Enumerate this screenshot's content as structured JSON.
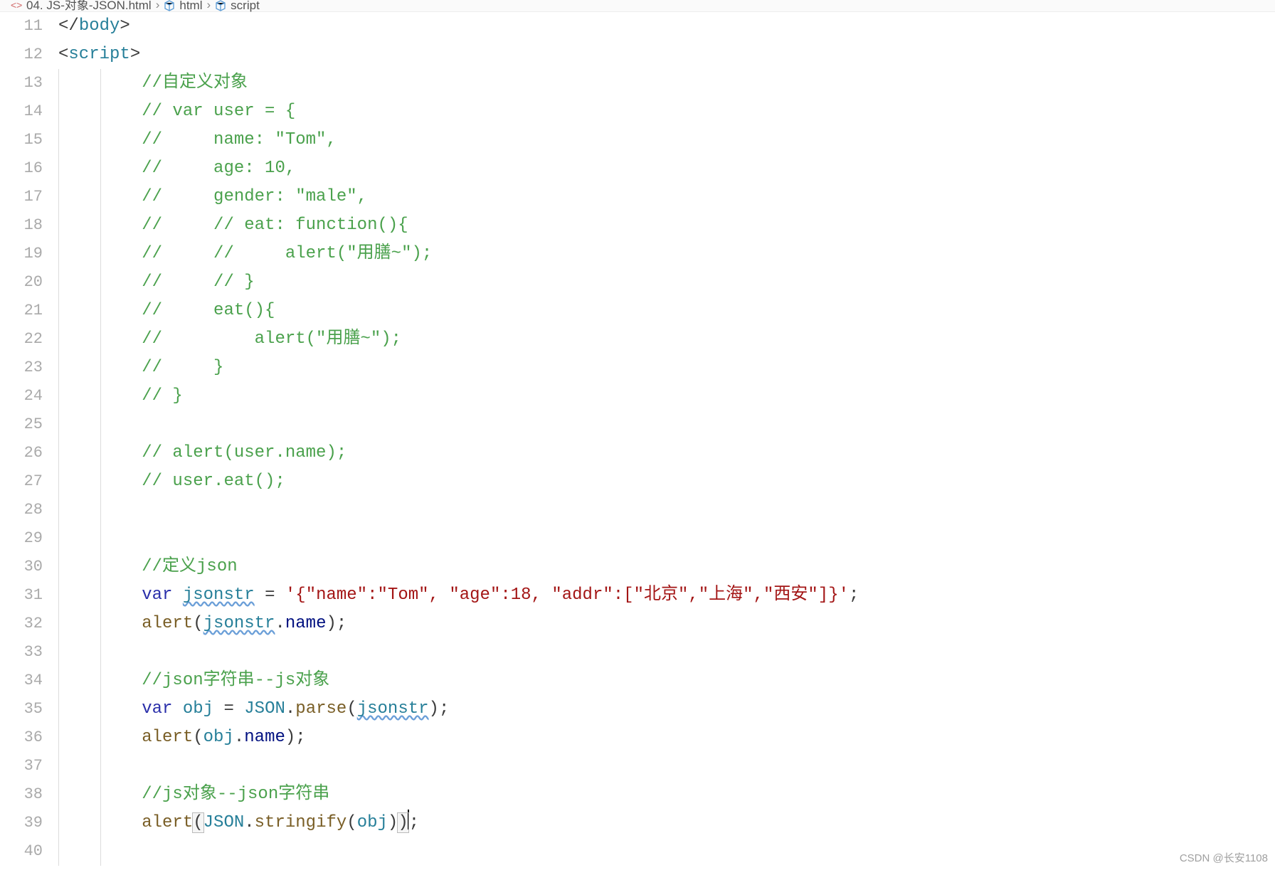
{
  "breadcrumb": {
    "file": "04. JS-对象-JSON.html",
    "path": [
      "html",
      "script"
    ]
  },
  "firstLine": 11,
  "lines": [
    {
      "html": "<span class='c-punc'>&lt;/</span><span class='c-tag'>body</span><span class='c-punc'>&gt;</span>",
      "indent": 0
    },
    {
      "html": "<span class='c-punc'>&lt;</span><span class='c-tag'>script</span><span class='c-punc'>&gt;</span>",
      "indent": 0
    },
    {
      "html": "<span class='c-comment'>//自定义对象</span>",
      "indent": 2
    },
    {
      "html": "<span class='c-comment'>// var user = {</span>",
      "indent": 2
    },
    {
      "html": "<span class='c-comment'>//     name: &quot;Tom&quot;,</span>",
      "indent": 2
    },
    {
      "html": "<span class='c-comment'>//     age: 10,</span>",
      "indent": 2
    },
    {
      "html": "<span class='c-comment'>//     gender: &quot;male&quot;,</span>",
      "indent": 2
    },
    {
      "html": "<span class='c-comment'>//     // eat: function(){</span>",
      "indent": 2
    },
    {
      "html": "<span class='c-comment'>//     //     alert(&quot;用膳~&quot;);</span>",
      "indent": 2
    },
    {
      "html": "<span class='c-comment'>//     // }</span>",
      "indent": 2
    },
    {
      "html": "<span class='c-comment'>//     eat(){</span>",
      "indent": 2
    },
    {
      "html": "<span class='c-comment'>//         alert(&quot;用膳~&quot;);</span>",
      "indent": 2
    },
    {
      "html": "<span class='c-comment'>//     }</span>",
      "indent": 2
    },
    {
      "html": "<span class='c-comment'>// }</span>",
      "indent": 2
    },
    {
      "html": "",
      "indent": 2
    },
    {
      "html": "<span class='c-comment'>// alert(user.name);</span>",
      "indent": 2
    },
    {
      "html": "<span class='c-comment'>// user.eat();</span>",
      "indent": 2
    },
    {
      "html": "",
      "indent": 2
    },
    {
      "html": "",
      "indent": 2
    },
    {
      "html": "<span class='c-comment'>//定义json</span>",
      "indent": 2
    },
    {
      "html": "<span class='c-keyword'>var</span> <span class='c-ident squiggle'>jsonstr</span> <span class='c-punc'>=</span> <span class='c-string'>'{&quot;name&quot;:&quot;Tom&quot;, &quot;age&quot;:18, &quot;addr&quot;:[&quot;北京&quot;,&quot;上海&quot;,&quot;西安&quot;]}'</span><span class='c-punc'>;</span>",
      "indent": 2
    },
    {
      "html": "<span class='c-func'>alert</span><span class='c-punc'>(</span><span class='c-ident squiggle'>jsonstr</span><span class='c-punc'>.</span><span class='c-prop'>name</span><span class='c-punc'>);</span>",
      "indent": 2
    },
    {
      "html": "",
      "indent": 2
    },
    {
      "html": "<span class='c-comment'>//json字符串--js对象</span>",
      "indent": 2
    },
    {
      "html": "<span class='c-keyword'>var</span> <span class='c-ident'>obj</span> <span class='c-punc'>=</span> <span class='c-ident'>JSON</span><span class='c-punc'>.</span><span class='c-func'>parse</span><span class='c-punc'>(</span><span class='c-ident squiggle'>jsonstr</span><span class='c-punc'>);</span>",
      "indent": 2
    },
    {
      "html": "<span class='c-func'>alert</span><span class='c-punc'>(</span><span class='c-ident'>obj</span><span class='c-punc'>.</span><span class='c-prop'>name</span><span class='c-punc'>);</span>",
      "indent": 2
    },
    {
      "html": "",
      "indent": 2
    },
    {
      "html": "<span class='c-comment'>//js对象--json字符串</span>",
      "indent": 2
    },
    {
      "html": "<span class='c-func'>alert</span><span class='c-punc bracket-hl'>(</span><span class='c-ident'>JSON</span><span class='c-punc'>.</span><span class='c-func'>stringify</span><span class='c-punc'>(</span><span class='c-ident'>obj</span><span class='c-punc'>)</span><span class='c-punc bracket-hl'>)</span><span class='cursor'></span><span class='c-punc'>;</span>",
      "indent": 2
    },
    {
      "html": "",
      "indent": 2
    }
  ],
  "watermark": "CSDN @长安1108"
}
